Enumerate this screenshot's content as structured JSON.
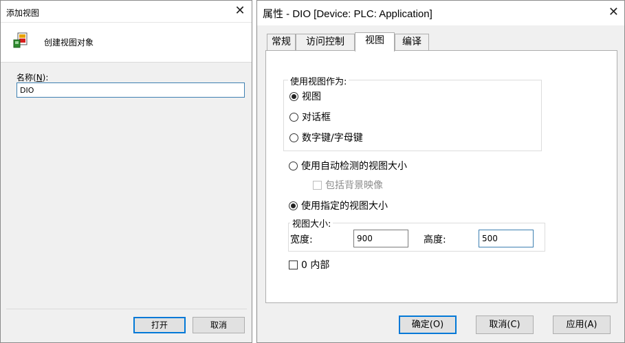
{
  "add_view_dialog": {
    "title": "添加视图",
    "close_glyph": "✕",
    "header_label": "创建视图对象",
    "header_icon": "create-view-icon",
    "name_label_prefix": "名称(",
    "name_label_key": "N",
    "name_label_suffix": "):",
    "name_value": "DIO",
    "open_label": "打开",
    "cancel_label": "取消"
  },
  "properties_dialog": {
    "title": "属性 - DIO [Device: PLC: Application]",
    "close_glyph": "✕",
    "tabs": [
      {
        "label": "常规",
        "active": false
      },
      {
        "label": "访问控制",
        "active": false
      },
      {
        "label": "视图",
        "active": true
      },
      {
        "label": "编译",
        "active": false
      }
    ],
    "use_view_as": {
      "title": "使用视图作为:",
      "options": [
        {
          "label": "视图",
          "checked": true
        },
        {
          "label": "对话框",
          "checked": false
        },
        {
          "label": "数字键/字母键",
          "checked": false
        }
      ]
    },
    "auto_size": {
      "label": "使用自动检测的视图大小",
      "checked": false
    },
    "include_bg": {
      "label": "包括背景映像",
      "checked": false,
      "enabled": false
    },
    "specified_size": {
      "label": "使用指定的视图大小",
      "checked": true
    },
    "size_group": {
      "title": "视图大小:",
      "width_label": "宽度:",
      "width_value": "900",
      "height_label": "高度:",
      "height_value": "500"
    },
    "internal": {
      "label": "0 内部",
      "checked": false
    },
    "ok_label": "确定(O)",
    "cancel_label": "取消(C)",
    "apply_label": "应用(A)"
  },
  "colors": {
    "dialog_bg": "#f0f0f0",
    "focus_border": "#0078d7",
    "input_focus": "#3c7fb1"
  }
}
